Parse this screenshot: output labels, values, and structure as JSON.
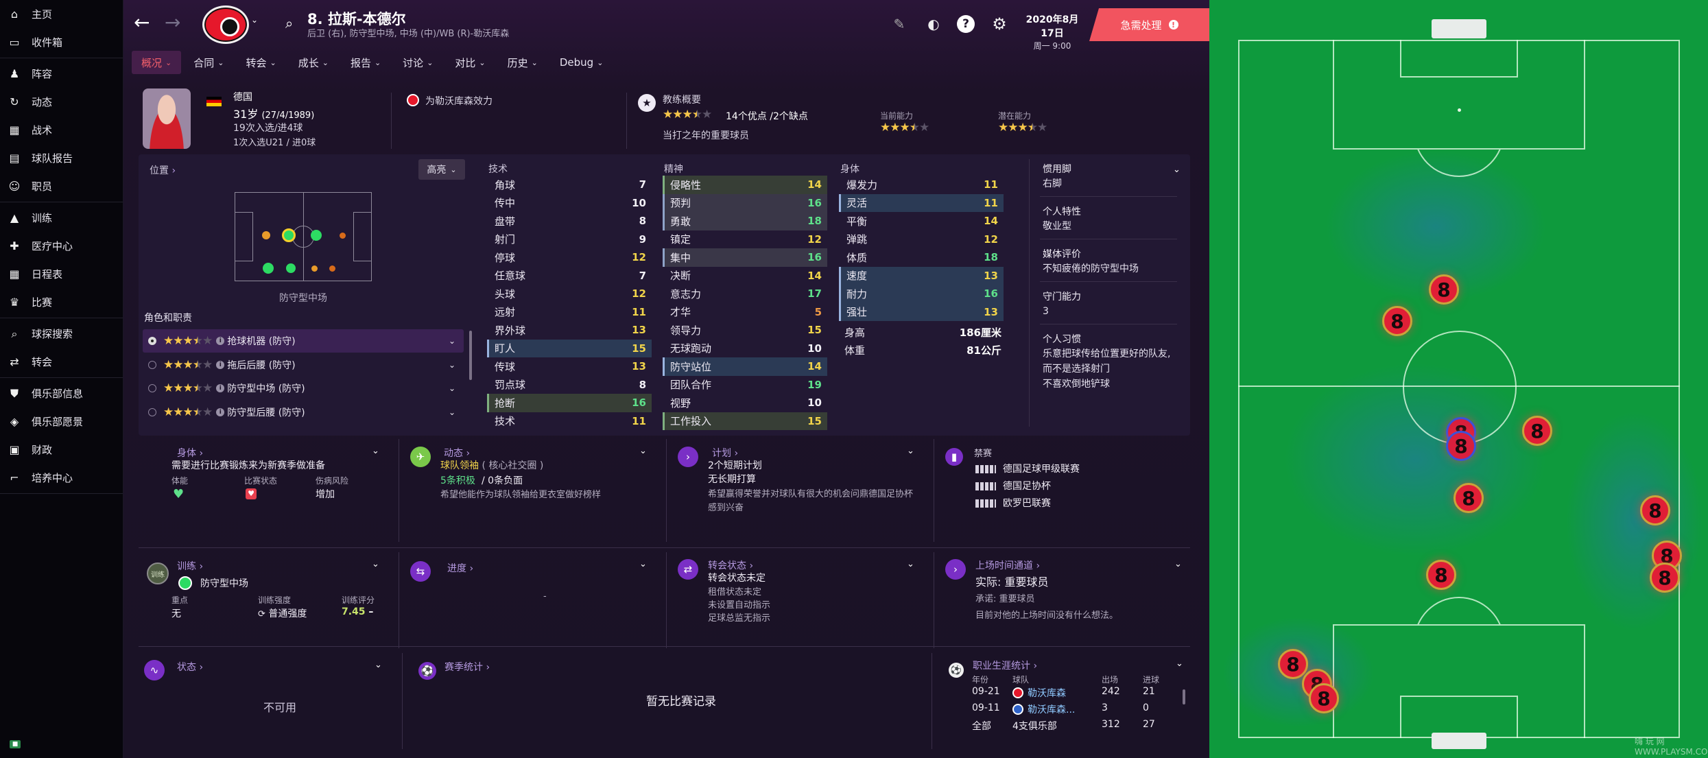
{
  "sidebar": {
    "items": [
      {
        "label": "主页",
        "icon": "home-icon",
        "glyph": "⌂"
      },
      {
        "label": "收件箱",
        "icon": "inbox-icon",
        "glyph": "▭"
      },
      {
        "label": "阵容",
        "icon": "squad-shirt-icon",
        "glyph": "♟"
      },
      {
        "label": "动态",
        "icon": "dynamics-icon",
        "glyph": "↻"
      },
      {
        "label": "战术",
        "icon": "tactics-icon",
        "glyph": "▦"
      },
      {
        "label": "球队报告",
        "icon": "report-icon",
        "glyph": "▤"
      },
      {
        "label": "职员",
        "icon": "staff-icon",
        "glyph": "☺"
      },
      {
        "label": "训练",
        "icon": "training-icon",
        "glyph": "▲"
      },
      {
        "label": "医疗中心",
        "icon": "medical-icon",
        "glyph": "✚"
      },
      {
        "label": "日程表",
        "icon": "calendar-icon",
        "glyph": "▦"
      },
      {
        "label": "比赛",
        "icon": "trophy-icon",
        "glyph": "♛"
      },
      {
        "label": "球探搜索",
        "icon": "search-icon",
        "glyph": "⌕"
      },
      {
        "label": "转会",
        "icon": "transfer-icon",
        "glyph": "⇄"
      },
      {
        "label": "俱乐部信息",
        "icon": "shield-icon",
        "glyph": "⛊"
      },
      {
        "label": "俱乐部愿景",
        "icon": "vision-icon",
        "glyph": "◈"
      },
      {
        "label": "财政",
        "icon": "finance-icon",
        "glyph": "▣"
      },
      {
        "label": "培养中心",
        "icon": "development-icon",
        "glyph": "⌐"
      }
    ]
  },
  "header": {
    "player_title": "8. 拉斯-本德尔",
    "player_subtitle": "后卫 (右), 防守型中场, 中场 (中)/WB (R)-勒沃库森",
    "date": "2020年8月17日",
    "time": "周一 9:00",
    "urgent_label": "急需处理",
    "urgent_mark": "!"
  },
  "menu": [
    {
      "label": "概况",
      "active": true
    },
    {
      "label": "合同"
    },
    {
      "label": "转会"
    },
    {
      "label": "成长"
    },
    {
      "label": "报告"
    },
    {
      "label": "讨论"
    },
    {
      "label": "对比"
    },
    {
      "label": "历史"
    },
    {
      "label": "Debug"
    }
  ],
  "profile": {
    "nation": "德国",
    "age_label": "31岁",
    "birth": "(27/4/1989)",
    "caps": "19次入选/进4球",
    "u21": "1次入选U21 / 进0球",
    "club_label": "为勒沃库森效力",
    "coach_title": "教练概要",
    "coach_stars": 3.5,
    "pros_cons": "14个优点 /2个缺点",
    "coach_note": "当打之年的重要球员",
    "current_ability_label": "当前能力",
    "current_ability": 3.5,
    "potential_label": "潜在能力",
    "potential": 3.5
  },
  "position_panel": {
    "title": "位置",
    "filter": "高亮",
    "position_name": "防守型中场",
    "roles_title": "角色和职责",
    "roles": [
      {
        "stars": 3.5,
        "label": "抢球机器 (防守)",
        "selected": true
      },
      {
        "stars": 3.5,
        "label": "拖后后腰 (防守)"
      },
      {
        "stars": 3.5,
        "label": "防守型中场 (防守)"
      },
      {
        "stars": 3.5,
        "label": "防守型后腰 (防守)"
      }
    ]
  },
  "attributes": {
    "technical_title": "技术",
    "technical": [
      [
        "角球",
        "7",
        "w",
        ""
      ],
      [
        "传中",
        "10",
        "w",
        ""
      ],
      [
        "盘带",
        "8",
        "w",
        ""
      ],
      [
        "射门",
        "9",
        "w",
        ""
      ],
      [
        "停球",
        "12",
        "y",
        ""
      ],
      [
        "任意球",
        "7",
        "w",
        ""
      ],
      [
        "头球",
        "12",
        "y",
        ""
      ],
      [
        "远射",
        "11",
        "y",
        ""
      ],
      [
        "界外球",
        "13",
        "y",
        ""
      ],
      [
        "盯人",
        "15",
        "y",
        "hl2"
      ],
      [
        "传球",
        "13",
        "y",
        ""
      ],
      [
        "罚点球",
        "8",
        "w",
        ""
      ],
      [
        "抢断",
        "16",
        "g",
        "hl3"
      ],
      [
        "技术",
        "11",
        "y",
        ""
      ]
    ],
    "mental_title": "精神",
    "mental": [
      [
        "侵略性",
        "14",
        "y",
        "hl3"
      ],
      [
        "预判",
        "16",
        "g",
        "hl"
      ],
      [
        "勇敢",
        "18",
        "g",
        "hl"
      ],
      [
        "镇定",
        "12",
        "y",
        ""
      ],
      [
        "集中",
        "16",
        "g",
        "hl"
      ],
      [
        "决断",
        "14",
        "y",
        ""
      ],
      [
        "意志力",
        "17",
        "g",
        ""
      ],
      [
        "才华",
        "5",
        "o",
        ""
      ],
      [
        "领导力",
        "15",
        "y",
        ""
      ],
      [
        "无球跑动",
        "10",
        "w",
        ""
      ],
      [
        "防守站位",
        "14",
        "y",
        "hl2"
      ],
      [
        "团队合作",
        "19",
        "g",
        ""
      ],
      [
        "视野",
        "10",
        "w",
        ""
      ],
      [
        "工作投入",
        "15",
        "y",
        "hl3"
      ]
    ],
    "physical_title": "身体",
    "physical": [
      [
        "爆发力",
        "11",
        "y",
        ""
      ],
      [
        "灵活",
        "11",
        "y",
        "hl2"
      ],
      [
        "平衡",
        "14",
        "y",
        ""
      ],
      [
        "弹跳",
        "12",
        "y",
        ""
      ],
      [
        "体质",
        "18",
        "g",
        ""
      ],
      [
        "速度",
        "13",
        "y",
        "hl2"
      ],
      [
        "耐力",
        "16",
        "g",
        "hl2"
      ],
      [
        "强壮",
        "13",
        "y",
        "hl2"
      ]
    ],
    "height_label": "身高",
    "height": "186厘米",
    "weight_label": "体重",
    "weight": "81公斤"
  },
  "traits": [
    {
      "title": "惯用脚",
      "value": "右脚"
    },
    {
      "title": "个人特性",
      "value": "敬业型"
    },
    {
      "title": "媒体评价",
      "value": "不知疲倦的防守型中场"
    },
    {
      "title": "守门能力",
      "value": "3"
    },
    {
      "title": "个人习惯",
      "value": "乐意把球传给位置更好的队友,\n而不是选择射门\n不喜欢倒地铲球"
    }
  ],
  "cards": {
    "body": {
      "title": "身体",
      "text": "需要进行比赛锻炼来为新赛季做准备",
      "l1": "体能",
      "l2": "比赛状态",
      "l3": "伤病风险",
      "v3": "增加"
    },
    "dynamics": {
      "title": "动态",
      "role": "球队领袖",
      "role_sub": "( 核心社交圈 )",
      "pos": "5条积极",
      "neg": "/ 0条负面",
      "text": "希望他能作为球队领袖给更衣室做好榜样"
    },
    "plan": {
      "title": "计划",
      "l1": "2个短期计划",
      "l2": "无长期打算",
      "l3": "希望赢得荣誉并对球队有很大的机会问鼎德国足协杯",
      "l4": "感到兴奋"
    },
    "ban": {
      "title": "禁赛",
      "items": [
        "德国足球甲级联赛",
        "德国足协杯",
        "欧罗巴联赛"
      ]
    },
    "training": {
      "title": "训练",
      "position": "防守型中场",
      "focus_label": "重点",
      "focus": "无",
      "intensity_label": "训练强度",
      "intensity": "普通强度",
      "rating_label": "训练评分",
      "rating": "7.45",
      "rating_trend": "–"
    },
    "progress": {
      "title": "进度",
      "value": "-"
    },
    "transfer": {
      "title": "转会状态",
      "l1": "转会状态未定",
      "l2": "租借状态未定",
      "l3": "未设置自动指示",
      "l4": "足球总监无指示"
    },
    "playing_time": {
      "title": "上场时间通道",
      "l1": "实际: 重要球员",
      "l2": "承诺: 重要球员",
      "l3": "目前对他的上场时间没有什么想法。"
    },
    "status": {
      "title": "状态",
      "value": "不可用"
    },
    "season": {
      "title": "赛季统计",
      "value": "暂无比赛记录"
    },
    "career": {
      "title": "职业生涯统计",
      "headers": [
        "年份",
        "球队",
        "出场",
        "进球"
      ],
      "rows": [
        [
          "09-21",
          "勒沃库森",
          "242",
          "21"
        ],
        [
          "09-11",
          "勒沃库森...",
          "3",
          "0"
        ]
      ],
      "total": [
        "全部",
        "4支俱乐部",
        "312",
        "27"
      ]
    }
  },
  "colors": {
    "accent": "#f2545f",
    "highlight": "#7a2fc6",
    "green": "#5ee08a",
    "yellow": "#f1d44a"
  },
  "pitch": {
    "shirt_number": "8",
    "watermark": "嗨 玩 网  WWW.PLAYSM.COM"
  }
}
